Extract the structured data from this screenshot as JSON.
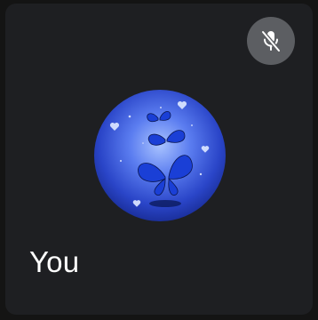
{
  "participant": {
    "name": "You",
    "mic_icon": "mic-off-icon",
    "avatar_icon": "butterfly-avatar"
  },
  "colors": {
    "tile_background": "#1e1f22",
    "mute_button": "#5c5e62",
    "avatar_accent": "#2a45c8"
  }
}
